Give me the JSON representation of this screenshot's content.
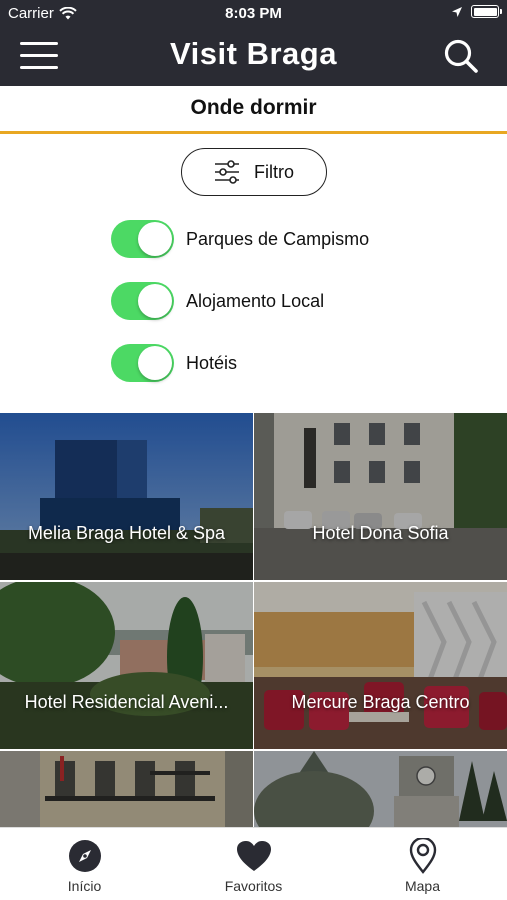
{
  "status_bar": {
    "carrier": "Carrier",
    "time": "8:03 PM"
  },
  "header": {
    "title": "Visit Braga"
  },
  "page": {
    "title": "Onde dormir"
  },
  "filter": {
    "label": "Filtro"
  },
  "toggles": [
    {
      "label": "Parques de Campismo",
      "on": true
    },
    {
      "label": "Alojamento Local",
      "on": true
    },
    {
      "label": "Hotéis",
      "on": true
    }
  ],
  "cards": [
    {
      "title": "Melia Braga Hotel & Spa"
    },
    {
      "title": "Hotel Dona Sofia"
    },
    {
      "title": "Hotel Residencial Aveni..."
    },
    {
      "title": "Mercure Braga Centro"
    },
    {
      "title": ""
    },
    {
      "title": ""
    }
  ],
  "tabs": [
    {
      "label": "Início",
      "icon": "compass-icon"
    },
    {
      "label": "Favoritos",
      "icon": "heart-icon"
    },
    {
      "label": "Mapa",
      "icon": "map-pin-icon"
    }
  ],
  "colors": {
    "header_bg": "#2a2b33",
    "accent": "#e8a722",
    "toggle_on": "#4cd964"
  }
}
